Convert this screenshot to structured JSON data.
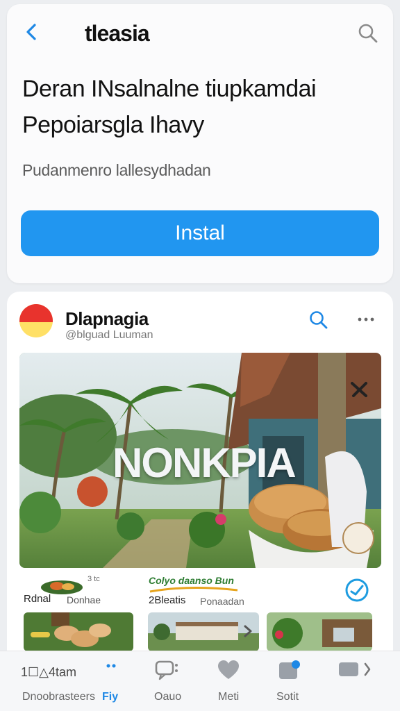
{
  "header": {
    "title": "tleasia"
  },
  "listing": {
    "headline_line1": "Deran INsalnalne tiupkamdai",
    "headline_line2": "Pepoiarsgla Ihavy",
    "subtitle": "Pudanmenro lallesydhadan",
    "install_label": "Instal"
  },
  "feed": {
    "account_name": "Dlapnagia",
    "account_handle": "@blguad Luuman",
    "hero_overlay_text": "NONKPIA",
    "info": {
      "tiny_a": "3 tc",
      "label_a1": "Rdnal",
      "label_a2": "Donhae",
      "brand_b": "Colyo daanso Bun",
      "label_b1": "2Bleatis",
      "label_b2": "Ponaadan"
    }
  },
  "bottom_nav": {
    "items": [
      {
        "label": "Dnoobrasteers",
        "icon_text": "1☐△4tam",
        "icon": "grid-icon",
        "active": false
      },
      {
        "label": "Fiy",
        "icon": "dots-icon",
        "active": true
      },
      {
        "label": "Oauo",
        "icon": "chat-icon",
        "active": false
      },
      {
        "label": "Meti",
        "icon": "heart-icon",
        "active": false
      },
      {
        "label": "Sotit",
        "icon": "notification-icon",
        "active": false
      }
    ]
  },
  "colors": {
    "accent": "#2196f0",
    "active_nav": "#1e88e5",
    "avatar_red": "#e8332d",
    "avatar_yellow": "#ffe066"
  }
}
